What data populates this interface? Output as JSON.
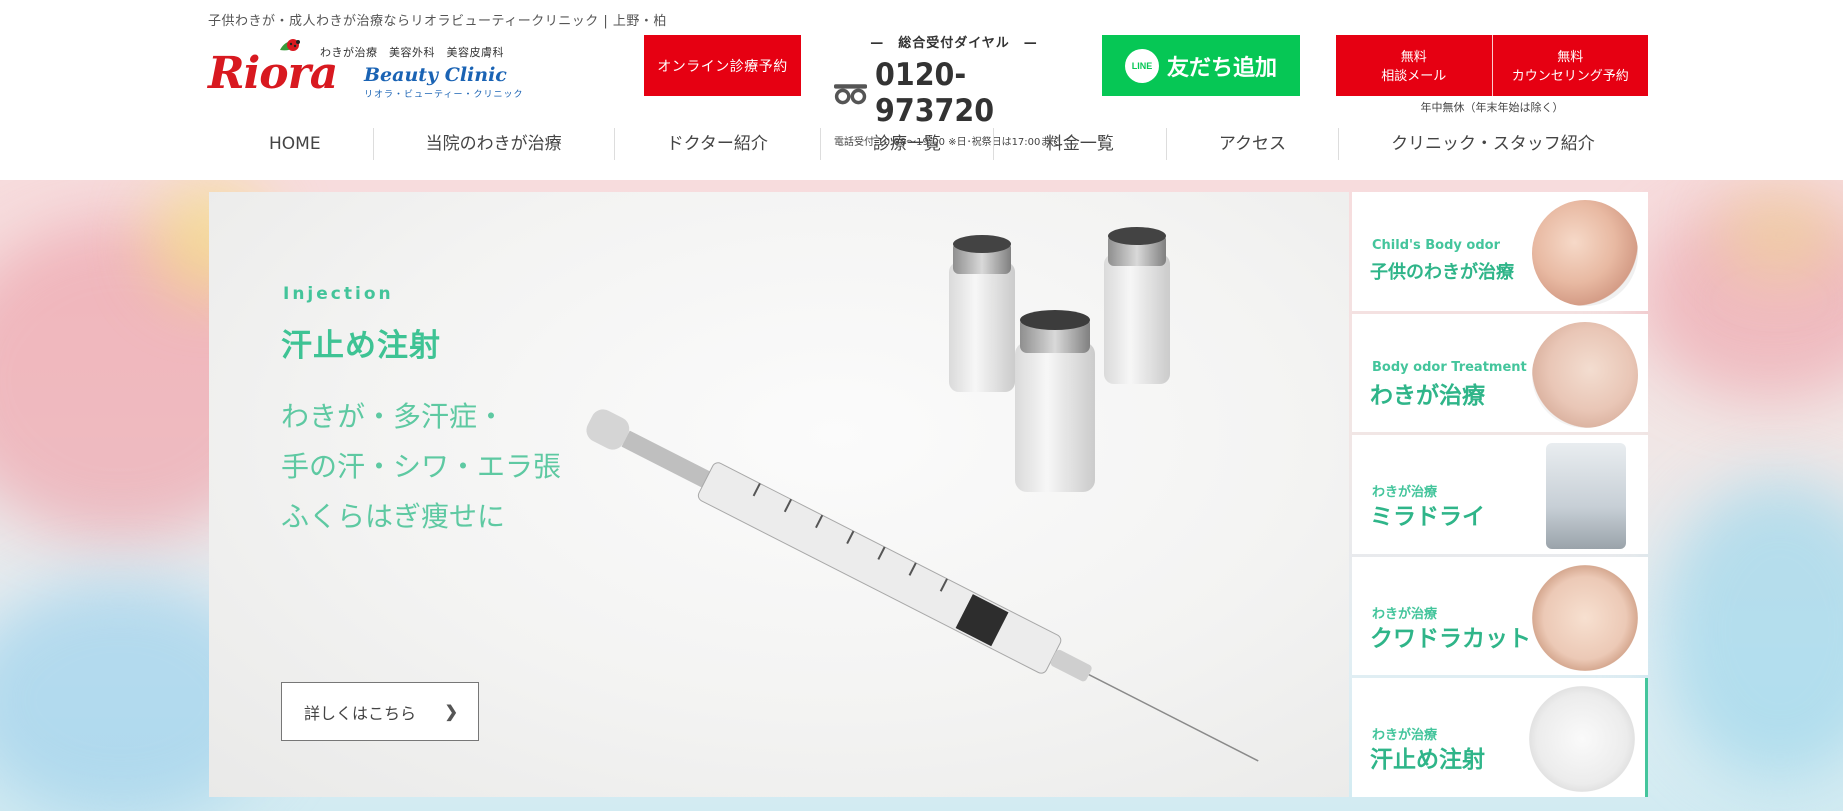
{
  "header": {
    "tagline": "子供わきが・成人わきが治療ならリオラビューティークリニック | 上野・柏",
    "logo": {
      "services": "わきが治療　美容外科　美容皮膚科",
      "name": "Riora",
      "subname": "Beauty Clinic",
      "kana": "リオラ・ビューティー・クリニック"
    },
    "online_booking_label": "オンライン診療予約",
    "phone": {
      "label": "—　総合受付ダイヤル　—",
      "number": "0120-973720",
      "hours": "電話受付:10:00〜19:00 ※日･祝祭日は17:00まで",
      "icon": "freedial-icon"
    },
    "line_button": {
      "icon_text": "LINE",
      "label": "友だち追加"
    },
    "mail_button_label": "無料\n相談メール",
    "counseling_button_label": "無料\nカウンセリング予約",
    "open_note": "年中無休（年末年始は除く）"
  },
  "nav": {
    "items": [
      {
        "label": "HOME"
      },
      {
        "label": "当院のわきが治療"
      },
      {
        "label": "ドクター紹介"
      },
      {
        "label": "診療一覧"
      },
      {
        "label": "料金一覧"
      },
      {
        "label": "アクセス"
      },
      {
        "label": "クリニック・スタッフ紹介"
      }
    ]
  },
  "hero": {
    "eyebrow": "Injection",
    "title": "汗止め注射",
    "body_lines": [
      "わきが・多汗症・",
      "手の汗・シワ・エラ張",
      "ふくらはぎ痩せに"
    ],
    "detail_button": "詳しくはこちら",
    "accent_color": "#3ec394"
  },
  "tiles": [
    {
      "sub": "Child's Body odor",
      "main": "子供のわきが治療",
      "big": false,
      "active": false
    },
    {
      "sub": "Body odor Treatment",
      "main": "わきが治療",
      "big": true,
      "active": false
    },
    {
      "sub": "わきが治療",
      "main": "ミラドライ",
      "big": true,
      "active": false
    },
    {
      "sub": "わきが治療",
      "main": "クワドラカット",
      "big": true,
      "active": false
    },
    {
      "sub": "わきが治療",
      "main": "汗止め注射",
      "big": true,
      "active": true
    }
  ],
  "colors": {
    "brand_red": "#e60012",
    "line_green": "#06c755",
    "accent_green": "#44c59c"
  }
}
